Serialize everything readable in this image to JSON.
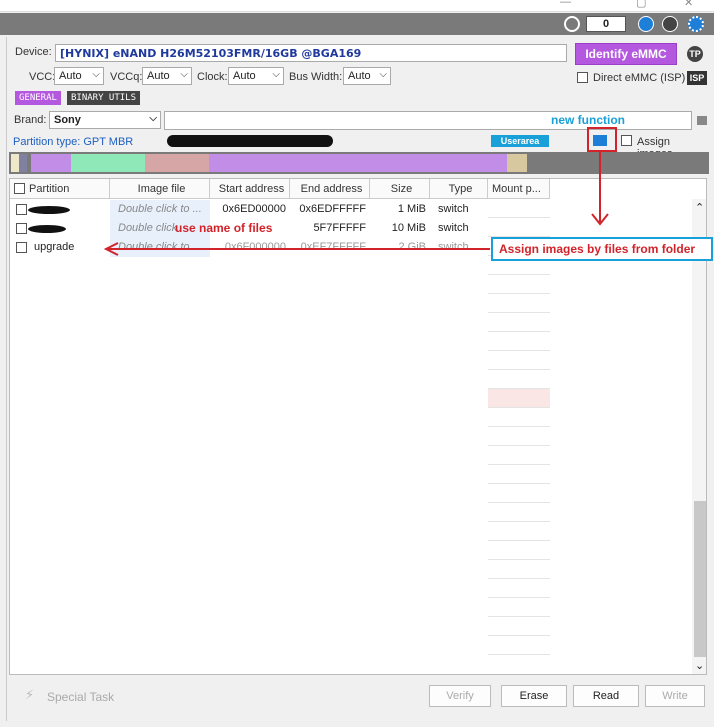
{
  "topbar": {
    "counter": "0"
  },
  "device": {
    "label": "Device:",
    "value": "[HYNIX] eNAND H26M52103FMR/16GB @BGA169",
    "identify_button": "Identify eMMC",
    "tp_badge": "TP",
    "direct_label": "Direct eMMC (ISP)",
    "isp_badge": "ISP"
  },
  "settings": {
    "vcc_label": "VCC:",
    "vcc_value": "Auto",
    "vccq_label": "VCCq:",
    "vccq_value": "Auto",
    "clock_label": "Clock:",
    "clock_value": "Auto",
    "buswidth_label": "Bus Width:",
    "buswidth_value": "Auto"
  },
  "tabs": [
    "GENERAL",
    "BINARY UTILS"
  ],
  "brand": {
    "label": "Brand:",
    "value": "Sony"
  },
  "partition_type": "Partition type: GPT MBR",
  "userarea": "Userarea",
  "assign_images": "Assign images",
  "annotations": {
    "new_function": "new function",
    "use_name": "use name of files",
    "assign_by_folder": "Assign images by files from folder"
  },
  "colors": {
    "purple": "#b458e0",
    "annotation_red": "#d2232a",
    "annotation_blue": "#1aa0d8",
    "segment_green": "#8ee8b8",
    "segment_pink": "#d6a6a6",
    "segment_purple": "#c28de6",
    "segment_tan": "#d8c8a0"
  },
  "table": {
    "headers": [
      "Partition",
      "Image file",
      "Start address",
      "End address",
      "Size",
      "Type",
      "Mount p..."
    ],
    "rows": [
      {
        "partition": "",
        "image": "Double click to ...",
        "start": "0x6ED00000",
        "end": "0x6EDFFFFF",
        "size": "1 MiB",
        "type": "switch"
      },
      {
        "partition": "",
        "image": "Double click",
        "start": "",
        "end": "5F7FFFFF",
        "size": "10 MiB",
        "type": "switch"
      },
      {
        "partition": "upgrade",
        "image": "Double click to ...",
        "start": "0x6F000000",
        "end": "0xEF7FFFFF",
        "size": "2 GiB",
        "type": "switch"
      }
    ]
  },
  "bottom": {
    "special_task": "Special Task",
    "verify": "Verify",
    "erase": "Erase",
    "read": "Read",
    "write": "Write"
  }
}
